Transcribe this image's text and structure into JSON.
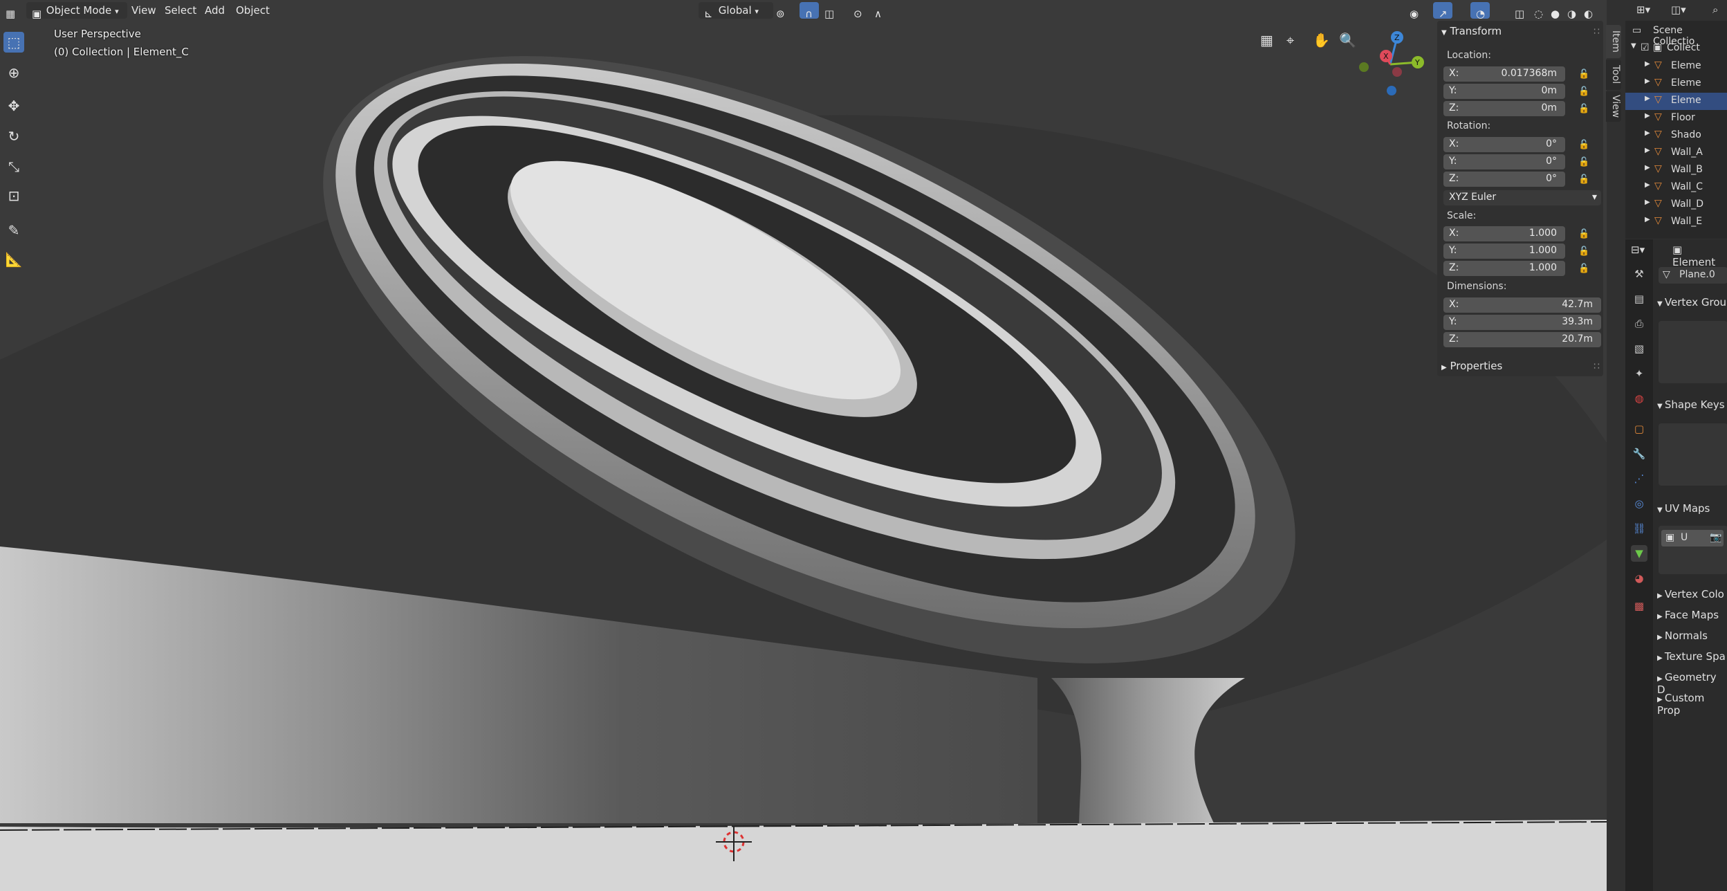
{
  "header": {
    "mode_label": "Object Mode",
    "menus": [
      "View",
      "Select",
      "Add",
      "Object"
    ],
    "orientation_label": "Global"
  },
  "viewport": {
    "perspective_label": "User Perspective",
    "collection_label": "(0) Collection | Element_C",
    "gizmo_axes": [
      "X",
      "Y",
      "Z"
    ]
  },
  "npanel": {
    "transform_title": "Transform",
    "location_label": "Location:",
    "location": {
      "x": "0.017368m",
      "y": "0m",
      "z": "0m"
    },
    "rotation_label": "Rotation:",
    "rotation": {
      "x": "0°",
      "y": "0°",
      "z": "0°"
    },
    "rotation_mode": "XYZ Euler",
    "scale_label": "Scale:",
    "scale": {
      "x": "1.000",
      "y": "1.000",
      "z": "1.000"
    },
    "dimensions_label": "Dimensions:",
    "dimensions": {
      "x": "42.7m",
      "y": "39.3m",
      "z": "20.7m"
    },
    "axis_labels": {
      "x": "X:",
      "y": "Y:",
      "z": "Z:"
    },
    "properties_title": "Properties",
    "tabs": [
      "Item",
      "Tool",
      "View"
    ]
  },
  "outliner": {
    "scene_collection": "Scene Collectio",
    "collection": "Collect",
    "items": [
      "Eleme",
      "Eleme",
      "Eleme",
      "Floor",
      "Shado",
      "Wall_A",
      "Wall_B",
      "Wall_C",
      "Wall_D",
      "Wall_E"
    ],
    "selected_index": 2
  },
  "properties": {
    "object_name": "Element",
    "mesh_name": "Plane.0",
    "sections": [
      "Vertex Grou",
      "Shape Keys",
      "UV Maps",
      "Vertex Colo",
      "Face Maps",
      "Normals",
      "Texture Spa",
      "Geometry D",
      "Custom Prop"
    ],
    "uv_map_item": "U"
  },
  "colors": {
    "accent": "#4772b3",
    "selected_row": "#334d80",
    "x_axis": "#e04a5a",
    "y_axis": "#8cbb2a",
    "z_axis": "#3d87d8"
  }
}
